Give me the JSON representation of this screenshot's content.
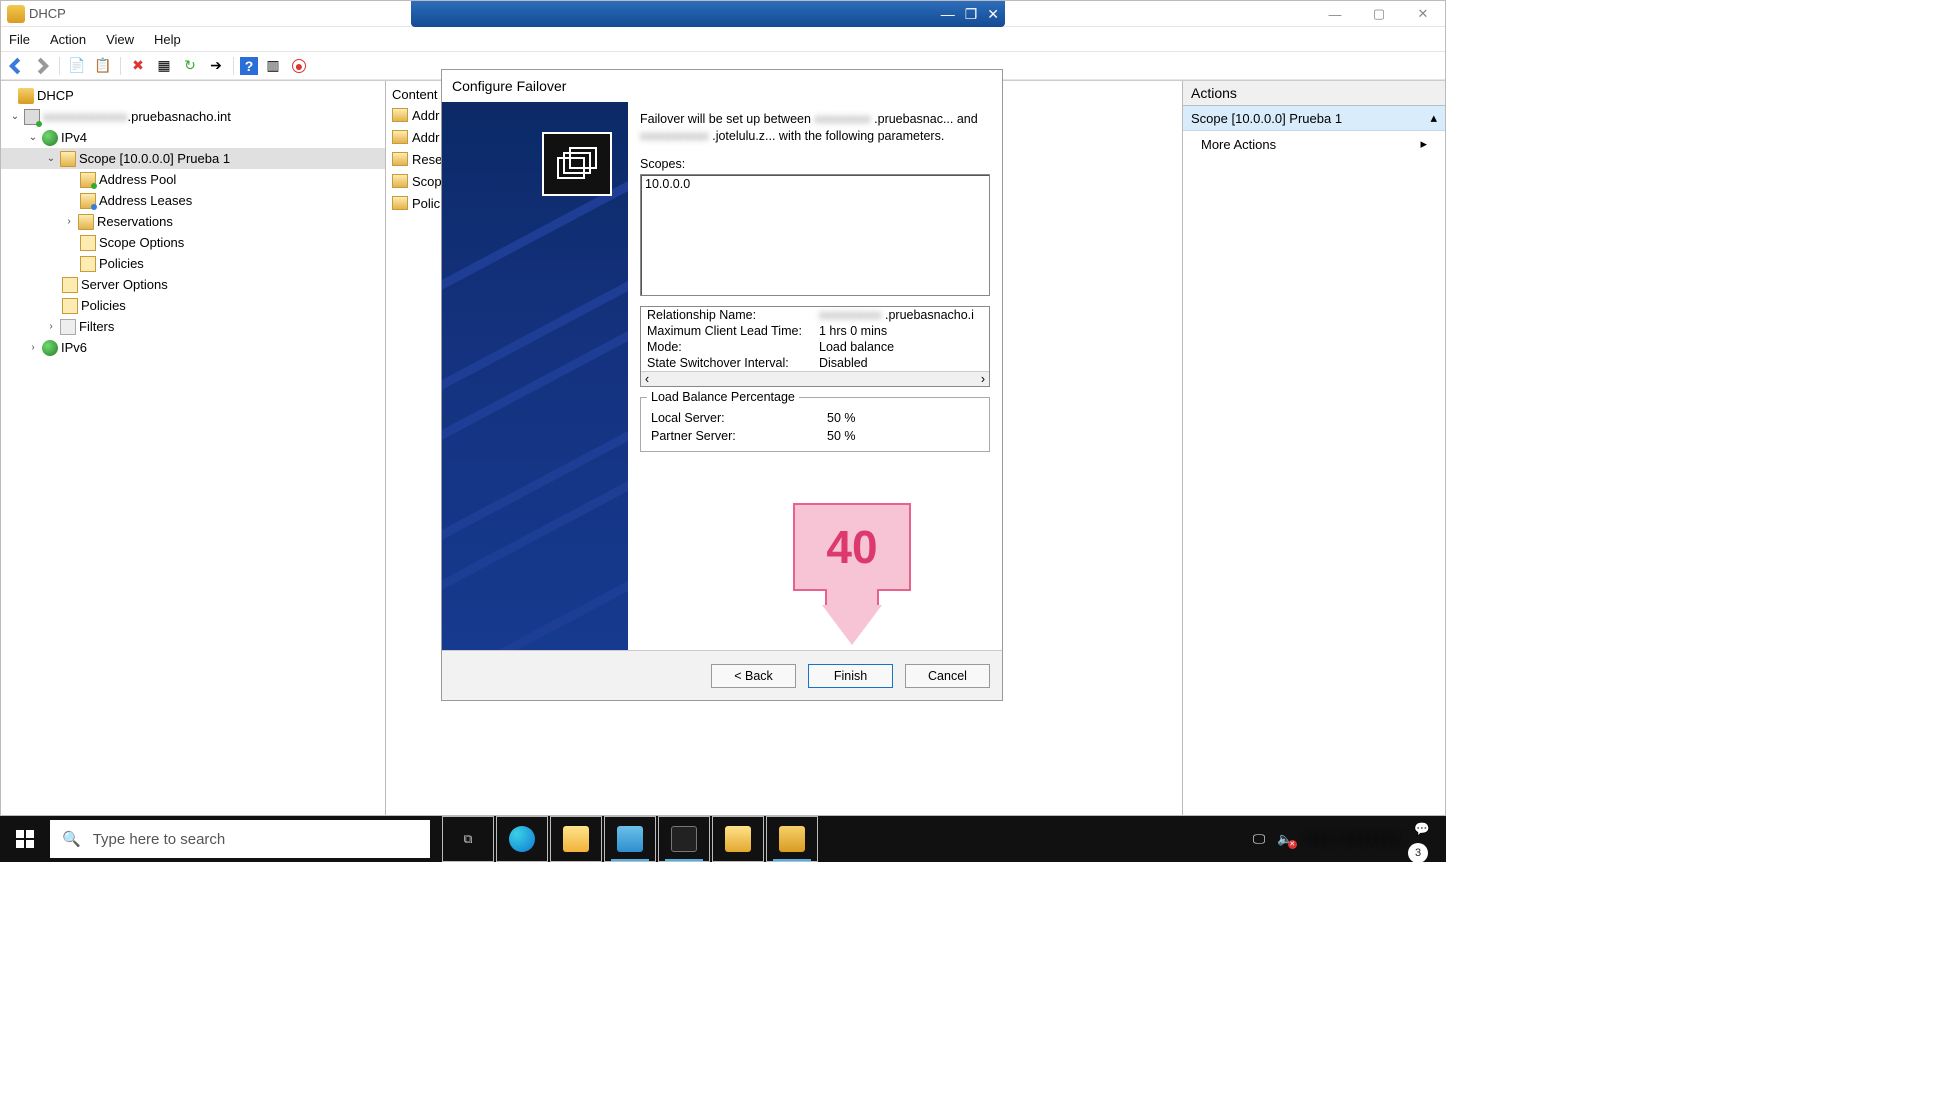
{
  "window": {
    "title": "DHCP",
    "menus": [
      "File",
      "Action",
      "View",
      "Help"
    ]
  },
  "tree": {
    "root": "DHCP",
    "server": ".pruebasnacho.int",
    "ipv4": "IPv4",
    "scope": "Scope [10.0.0.0] Prueba 1",
    "addr_pool": "Address Pool",
    "addr_leases": "Address Leases",
    "reservations": "Reservations",
    "scope_options": "Scope Options",
    "policies": "Policies",
    "server_options": "Server Options",
    "filters": "Filters",
    "ipv6": "IPv6"
  },
  "content": {
    "header": "Content",
    "items": [
      "Addr",
      "Addr",
      "Rese",
      "Scop",
      "Polic"
    ]
  },
  "actions": {
    "header": "Actions",
    "scope": "Scope [10.0.0.0] Prueba 1",
    "more": "More Actions"
  },
  "dialog": {
    "title": "Configure Failover",
    "intro1a": "Failover will be set up between ",
    "intro1b": ".pruebasnac... and",
    "intro2": ".jotelulu.z... with the following parameters.",
    "scopes_label": "Scopes:",
    "scopes_value": "10.0.0.0",
    "rel_name_k": "Relationship Name:",
    "rel_name_v": ".pruebasnacho.i",
    "mclt_k": "Maximum Client Lead Time:",
    "mclt_v": "1 hrs 0 mins",
    "mode_k": "Mode:",
    "mode_v": "Load balance",
    "ssi_k": "State Switchover Interval:",
    "ssi_v": "Disabled",
    "lbp_legend": "Load Balance Percentage",
    "local_k": "Local Server:",
    "local_v": "50 %",
    "partner_k": "Partner Server:",
    "partner_v": "50 %",
    "back": "< Back",
    "finish": "Finish",
    "cancel": "Cancel"
  },
  "annotation": {
    "label": "40"
  },
  "taskbar": {
    "search_placeholder": "Type here to search",
    "notifications_count": "3"
  }
}
